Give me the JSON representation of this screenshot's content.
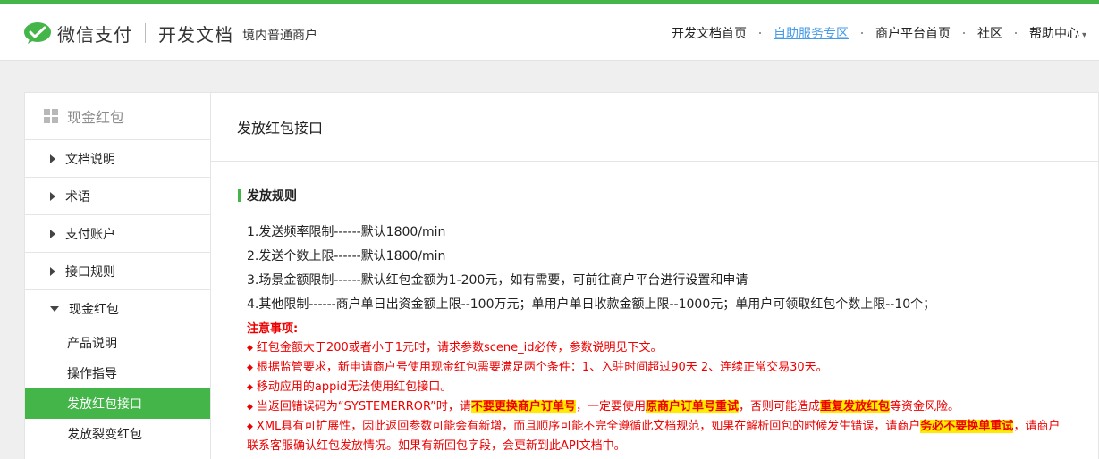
{
  "header": {
    "brand": "微信支付",
    "title": "开发文档",
    "subtitle": "境内普通商户",
    "nav": [
      "开发文档首页",
      "自助服务专区",
      "商户平台首页",
      "社区",
      "帮助中心"
    ]
  },
  "sidebar": {
    "title": "现金红包",
    "items": [
      "文档说明",
      "术语",
      "支付账户",
      "接口规则"
    ],
    "open_item": "现金红包",
    "sub_items": [
      "产品说明",
      "操作指导",
      "发放红包接口",
      "发放裂变红包"
    ]
  },
  "main": {
    "title": "发放红包接口",
    "section_title": "发放规则",
    "rules": [
      "1.发送频率限制------默认1800/min",
      "2.发送个数上限------默认1800/min",
      "3.场景金额限制------默认红包金额为1-200元，如有需要，可前往商户平台进行设置和申请",
      "4.其他限制------商户单日出资金额上限--100万元；单用户单日收款金额上限--1000元；单用户可领取红包个数上限--10个；"
    ],
    "notes_title": "注意事项:",
    "notes": {
      "n1": "红包金额大于200或者小于1元时，请求参数scene_id必传，参数说明见下文。",
      "n2": "根据监管要求，新申请商户号使用现金红包需要满足两个条件：1、入驻时间超过90天 2、连续正常交易30天。",
      "n3": "移动应用的appid无法使用红包接口。",
      "n4_a": "当返回错误码为“SYSTEMERROR”时，请",
      "n4_b": "不要更换商户订单号",
      "n4_c": "，一定要使用",
      "n4_d": "原商户订单号重试",
      "n4_e": "，否则可能造成",
      "n4_f": "重复发放红包",
      "n4_g": "等资金风险。",
      "n5_a": "XML具有可扩展性，因此返回参数可能会有新增，而且顺序可能不完全遵循此文档规范，如果在解析回包的时候发生错误，请商户",
      "n5_b": "务必不要换单重试",
      "n5_c": "，请商户联系客服确认红包发放情况。如果有新回包字段，会更新到此API文档中。"
    }
  },
  "colors": {
    "accent": "#44b549",
    "link": "#459ae9",
    "warn": "#e00000",
    "highlight": "#ffea00"
  }
}
